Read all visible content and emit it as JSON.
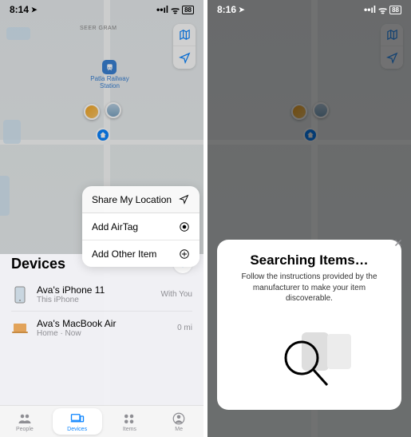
{
  "left": {
    "status": {
      "time": "8:14",
      "loc_arrow": "➤",
      "signal": "••ıl",
      "wifi": "ᯤ",
      "battery": "88"
    },
    "map": {
      "area_label": "SEER GRAM",
      "station_label": "Patla Railway Station"
    },
    "popup": {
      "share": "Share My Location",
      "airtag": "Add AirTag",
      "other": "Add Other Item"
    },
    "sheet": {
      "title": "Devices",
      "rows": [
        {
          "name": "Ava's iPhone 11",
          "sub": "This iPhone",
          "meta": "With You"
        },
        {
          "name": "Ava's MacBook Air",
          "sub": "Home · Now",
          "meta": "0 mi"
        }
      ]
    },
    "tabs": {
      "people": "People",
      "devices": "Devices",
      "items": "Items",
      "me": "Me"
    }
  },
  "right": {
    "status": {
      "time": "8:16",
      "loc_arrow": "➤",
      "signal": "••ıl",
      "wifi": "ᯤ",
      "battery": "88"
    },
    "modal": {
      "title": "Searching Items…",
      "desc": "Follow the instructions provided by the manufacturer to make your item discoverable."
    }
  }
}
